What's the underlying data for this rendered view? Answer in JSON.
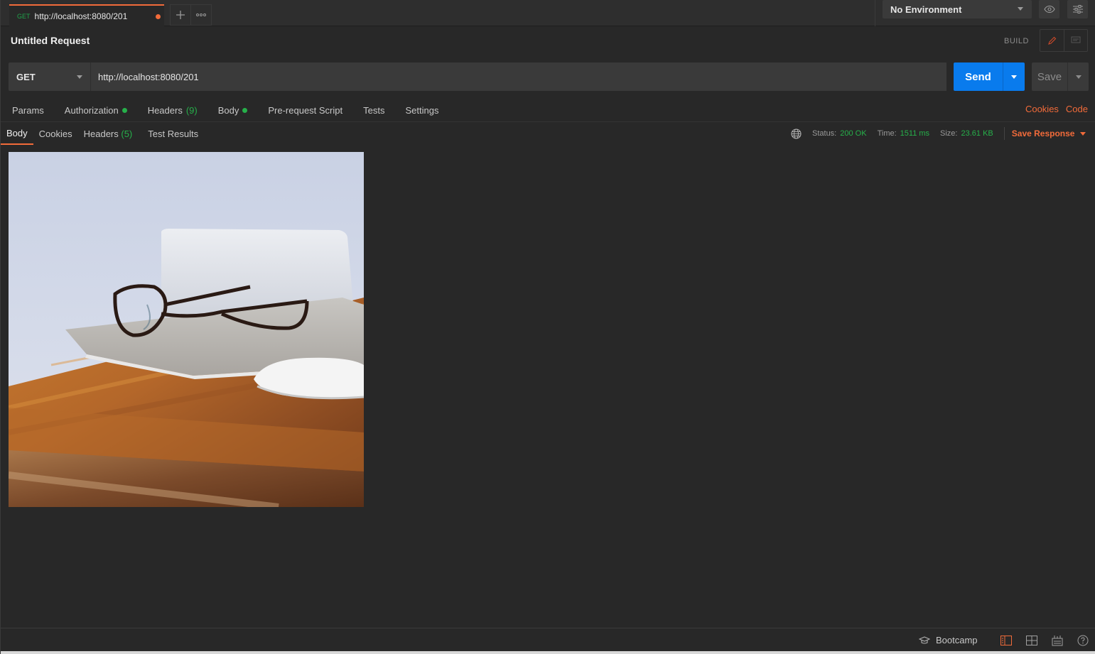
{
  "tabs": [
    {
      "method": "GET",
      "url": "http://localhost:8080/201",
      "unsaved": true
    }
  ],
  "environment": {
    "selected": "No Environment"
  },
  "request": {
    "title": "Untitled Request",
    "mode_label": "BUILD",
    "method": "GET",
    "url": "http://localhost:8080/201",
    "send_label": "Send",
    "save_label": "Save"
  },
  "request_tabs": {
    "params": "Params",
    "authorization": "Authorization",
    "headers": "Headers",
    "headers_count": "(9)",
    "body": "Body",
    "prerequest": "Pre-request Script",
    "tests": "Tests",
    "settings": "Settings",
    "cookies_link": "Cookies",
    "code_link": "Code"
  },
  "response_tabs": {
    "body": "Body",
    "cookies": "Cookies",
    "headers": "Headers",
    "headers_count": "(5)",
    "test_results": "Test Results"
  },
  "response_status": {
    "status_label": "Status:",
    "status_value": "200 OK",
    "time_label": "Time:",
    "time_value": "1511 ms",
    "size_label": "Size:",
    "size_value": "23.61 KB",
    "save_response": "Save Response"
  },
  "footer": {
    "bootcamp": "Bootcamp"
  },
  "colors": {
    "accent": "#f26b3a",
    "send_blue": "#097bed",
    "success_green": "#26b04a",
    "background": "#282828"
  }
}
